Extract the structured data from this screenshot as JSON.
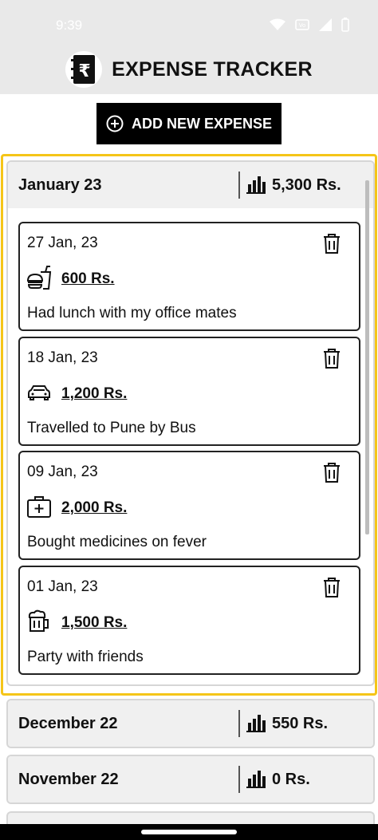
{
  "status": {
    "time": "9:39"
  },
  "header": {
    "title": "EXPENSE TRACKER"
  },
  "add_button": {
    "label": "ADD NEW EXPENSE"
  },
  "months": [
    {
      "name": "January 23",
      "total": "5,300 Rs.",
      "expenses": [
        {
          "date": "27 Jan, 23",
          "amount": "600 Rs.",
          "description": "Had lunch with my office mates",
          "icon": "food-icon"
        },
        {
          "date": "18 Jan, 23",
          "amount": "1,200 Rs.",
          "description": "Travelled to Pune by Bus",
          "icon": "car-icon"
        },
        {
          "date": "09 Jan, 23",
          "amount": "2,000 Rs.",
          "description": "Bought medicines on fever",
          "icon": "medical-kit-icon"
        },
        {
          "date": "01 Jan, 23",
          "amount": "1,500 Rs.",
          "description": "Party with friends",
          "icon": "beer-mug-icon"
        }
      ]
    },
    {
      "name": "December 22",
      "total": "550 Rs."
    },
    {
      "name": "November 22",
      "total": "0 Rs."
    }
  ],
  "colors": {
    "accent_frame": "#f5c518",
    "button_bg": "#000000",
    "header_bg": "#e9e9e9"
  }
}
